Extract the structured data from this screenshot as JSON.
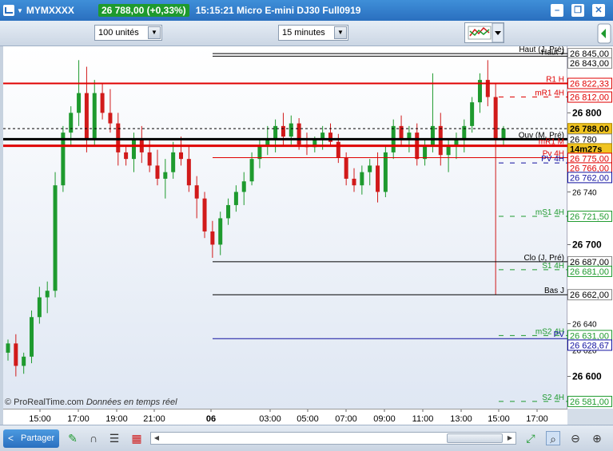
{
  "titlebar": {
    "symbol": "MYMXXXX",
    "price_badge": "26 788,00 (+0,33%)",
    "description": "15:15:21 Micro E-mini DJ30 Full0919",
    "buttons": [
      "minimize-icon",
      "restore-icon",
      "close-icon"
    ]
  },
  "toolbar": {
    "units_value": "100 unités",
    "interval_value": "15 minutes"
  },
  "chart": {
    "watermark": "© ProRealTime.com",
    "watermark_sub": "Données en temps réel",
    "colors": {
      "up": "#1e9a2e",
      "down": "#d11a1a",
      "pivot": "#000000",
      "resistance": "#e00000",
      "support": "#1e9a2e",
      "blue": "#1010a0"
    }
  },
  "price_axis": {
    "ticks": [
      "26 800",
      "26 740",
      "26 700",
      "26 640",
      "26 620",
      "26 600"
    ],
    "tick_values": [
      26800,
      26740,
      26700,
      26640,
      26620,
      26600
    ]
  },
  "levels": [
    {
      "name": "Haut (J, Pré)",
      "value": "26 845,00"
    },
    {
      "name": "Haut J",
      "value": "26 843,00"
    },
    {
      "name": "R1 H",
      "value": "26 822,33"
    },
    {
      "name": "mR1 4H",
      "value": "26 812,00"
    },
    {
      "name": "current",
      "value": "26 788,00"
    },
    {
      "name": "Ouv (M, Pré)",
      "value": "26 780"
    },
    {
      "name": "countdown",
      "value": "14m27s"
    },
    {
      "name": "mR1 M",
      "value": "26 775,00"
    },
    {
      "name": "Pv 4H",
      "value": "26 766,00"
    },
    {
      "name": "PV 4H",
      "value": "26 762,00"
    },
    {
      "name": "mS1 4H",
      "value": "26 721,50"
    },
    {
      "name": "Clo (J, Pré)",
      "value": "26 687,00"
    },
    {
      "name": "S1 4H",
      "value": "26 681,00"
    },
    {
      "name": "Bas J",
      "value": "26 662,00"
    },
    {
      "name": "mS2 4H",
      "value": "26 631,00"
    },
    {
      "name": "PV",
      "value": "26 628,67"
    },
    {
      "name": "S2 4H",
      "value": "26 581,00"
    }
  ],
  "time_axis": [
    "15:00",
    "17:00",
    "19:00",
    "21:00",
    "06",
    "03:00",
    "05:00",
    "07:00",
    "09:00",
    "11:00",
    "13:00",
    "15:00",
    "17:00"
  ],
  "bottombar": {
    "share_label": "Partager"
  },
  "candles": [
    [
      26618,
      26628,
      26612,
      26625
    ],
    [
      26625,
      26632,
      26600,
      26608
    ],
    [
      26608,
      26618,
      26602,
      26615
    ],
    [
      26615,
      26650,
      26610,
      26645
    ],
    [
      26645,
      26668,
      26640,
      26660
    ],
    [
      26660,
      26672,
      26648,
      26665
    ],
    [
      26665,
      26755,
      26660,
      26745
    ],
    [
      26745,
      26790,
      26740,
      26785
    ],
    [
      26785,
      26805,
      26775,
      26800
    ],
    [
      26800,
      26840,
      26790,
      26815
    ],
    [
      26815,
      26835,
      26770,
      26780
    ],
    [
      26780,
      26825,
      26775,
      26815
    ],
    [
      26815,
      26822,
      26795,
      26800
    ],
    [
      26800,
      26818,
      26785,
      26792
    ],
    [
      26792,
      26800,
      26760,
      26770
    ],
    [
      26770,
      26775,
      26760,
      26765
    ],
    [
      26765,
      26785,
      26755,
      26780
    ],
    [
      26780,
      26790,
      26762,
      26770
    ],
    [
      26770,
      26780,
      26755,
      26760
    ],
    [
      26760,
      26772,
      26745,
      26750
    ],
    [
      26750,
      26765,
      26735,
      26755
    ],
    [
      26755,
      26778,
      26750,
      26770
    ],
    [
      26770,
      26782,
      26760,
      26765
    ],
    [
      26765,
      26775,
      26740,
      26745
    ],
    [
      26745,
      26752,
      26720,
      26735
    ],
    [
      26735,
      26740,
      26705,
      26710
    ],
    [
      26710,
      26718,
      26690,
      26700
    ],
    [
      26700,
      26725,
      26692,
      26720
    ],
    [
      26720,
      26735,
      26715,
      26730
    ],
    [
      26730,
      26745,
      26725,
      26740
    ],
    [
      26740,
      26755,
      26730,
      26748
    ],
    [
      26748,
      26770,
      26745,
      26765
    ],
    [
      26765,
      26780,
      26758,
      26775
    ],
    [
      26775,
      26790,
      26768,
      26780
    ],
    [
      26780,
      26795,
      26770,
      26790
    ],
    [
      26790,
      26800,
      26775,
      26782
    ],
    [
      26782,
      26798,
      26776,
      26792
    ],
    [
      26792,
      26796,
      26772,
      26776
    ],
    [
      26776,
      26785,
      26768,
      26774
    ],
    [
      26774,
      26782,
      26770,
      26780
    ],
    [
      26780,
      26790,
      26772,
      26785
    ],
    [
      26785,
      26792,
      26775,
      26778
    ],
    [
      26778,
      26784,
      26762,
      26766
    ],
    [
      26766,
      26770,
      26745,
      26750
    ],
    [
      26750,
      26758,
      26740,
      26745
    ],
    [
      26745,
      26760,
      26738,
      26755
    ],
    [
      26755,
      26765,
      26745,
      26760
    ],
    [
      26760,
      26770,
      26732,
      26740
    ],
    [
      26740,
      26775,
      26736,
      26770
    ],
    [
      26770,
      26795,
      26765,
      26790
    ],
    [
      26790,
      26798,
      26775,
      26780
    ],
    [
      26780,
      26790,
      26770,
      26785
    ],
    [
      26785,
      26792,
      26760,
      26765
    ],
    [
      26765,
      26780,
      26760,
      26775
    ],
    [
      26775,
      26830,
      26770,
      26790
    ],
    [
      26790,
      26800,
      26760,
      26768
    ],
    [
      26768,
      26780,
      26755,
      26775
    ],
    [
      26775,
      26785,
      26765,
      26780
    ],
    [
      26780,
      26795,
      26770,
      26790
    ],
    [
      26790,
      26812,
      26785,
      26808
    ],
    [
      26808,
      26830,
      26800,
      26825
    ],
    [
      26825,
      26840,
      26805,
      26812
    ],
    [
      26812,
      26822,
      26662,
      26780
    ],
    [
      26780,
      26790,
      26775,
      26788
    ]
  ]
}
